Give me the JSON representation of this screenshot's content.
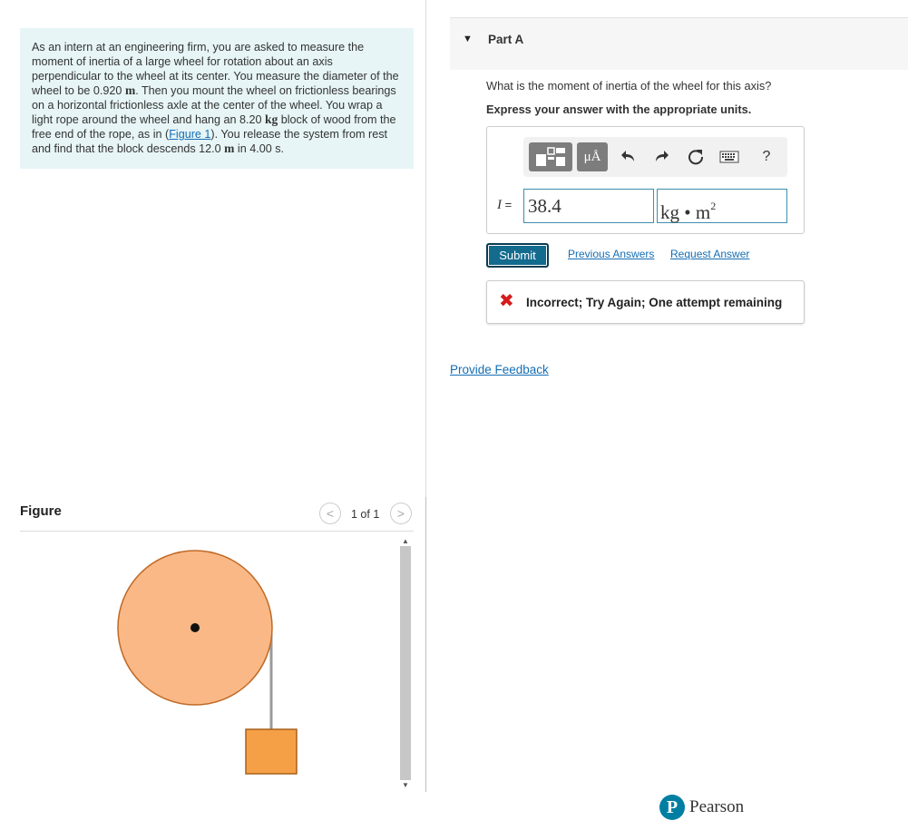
{
  "problem": {
    "t1": "As an intern at an engineering firm, you are asked to measure the moment of inertia of a large wheel for rotation about an axis perpendicular to the wheel at its center. You measure the diameter of the wheel to be ",
    "diameter": "0.920",
    "unit_m1": "m",
    "t2": ". Then you mount the wheel on frictionless bearings on a horizontal frictionless axle at the center of the wheel. You wrap a light rope around the wheel and hang an ",
    "mass": "8.20",
    "unit_kg": "kg",
    "t3": " block of wood from the free end of the rope, as in (",
    "figure_link": "Figure 1",
    "t4": "). You release the system from rest and find that the block descends ",
    "distance": "12.0",
    "unit_m2": "m",
    "t5": " in ",
    "time": "4.00 s",
    "t6": "."
  },
  "figure": {
    "title": "Figure",
    "counter": "1 of 1",
    "prev_icon": "chevron-left-icon",
    "next_icon": "chevron-right-icon",
    "colors": {
      "wheel_fill": "#f9b886",
      "wheel_stroke": "#c06a26",
      "block_fill": "#f5a047",
      "block_stroke": "#a8611b",
      "rope": "#9a9a9a"
    }
  },
  "part": {
    "title": "Part A",
    "question": "What is the moment of inertia of the wheel for this axis?",
    "instruction": "Express your answer with the appropriate units."
  },
  "toolbar": {
    "units_label": "μÅ",
    "help_label": "?",
    "icons": [
      "templates-icon",
      "units-icon",
      "undo-icon",
      "redo-icon",
      "reset-icon",
      "keyboard-icon",
      "help-icon"
    ]
  },
  "answer": {
    "variable": "I",
    "equals": " =",
    "value": "38.4",
    "units_base": "kg • m",
    "units_exp": "2"
  },
  "actions": {
    "submit": "Submit",
    "previous_answers": "Previous Answers",
    "request_answer": "Request Answer"
  },
  "feedback": {
    "message": "Incorrect; Try Again; One attempt remaining",
    "icon": "x-icon",
    "color": "#d51c1c"
  },
  "footer": {
    "provide_feedback": "Provide Feedback",
    "brand": "Pearson",
    "brand_color": "#007fa3"
  }
}
